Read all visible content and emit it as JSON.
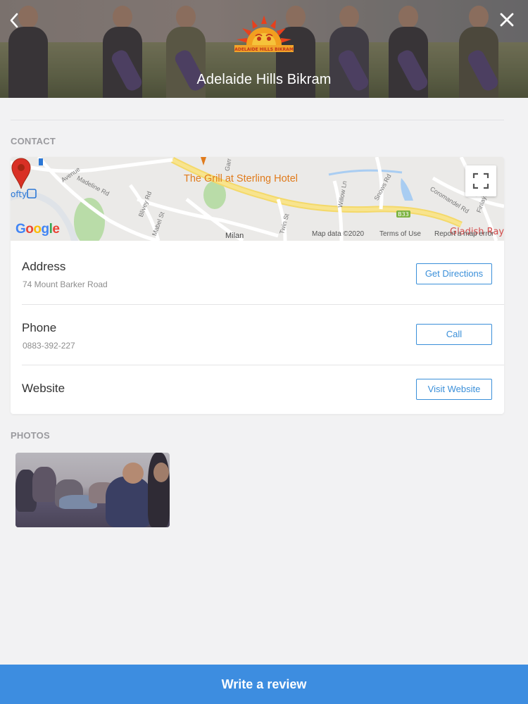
{
  "header": {
    "title": "Adelaide Hills Bikram",
    "back_icon": "chevron-left-icon",
    "close_icon": "close-icon",
    "logo_text": "ADELAIDE HILLS BIKRAM"
  },
  "contact": {
    "section_label": "CONTACT",
    "map": {
      "place_label": "The Grill at Sterling Hotel",
      "streets": [
        "Avenue",
        "Madeline Rd",
        "Mabel St",
        "Blivey Rd",
        "Twin St",
        "Milan",
        "Willow Ln",
        "Snows Rd",
        "Coromandel Rd",
        "Finlayson Dr",
        "Garr"
      ],
      "road_shield": "B33",
      "left_label": "ofty",
      "right_label": "Gladish Ray",
      "attribution": {
        "map_data": "Map data ©2020",
        "terms": "Terms of Use",
        "report": "Report a map error"
      }
    },
    "address": {
      "title": "Address",
      "value": "74 Mount Barker Road",
      "button": "Get Directions"
    },
    "phone": {
      "title": "Phone",
      "value": "0883-392-227",
      "button": "Call"
    },
    "website": {
      "title": "Website",
      "button": "Visit Website"
    }
  },
  "photos": {
    "section_label": "PHOTOS"
  },
  "footer": {
    "review_button": "Write a review"
  },
  "colors": {
    "accent": "#3d8de0",
    "button_outline": "#3a8fd9",
    "map_pin": "#d93025",
    "place_label": "#e07b1c"
  }
}
